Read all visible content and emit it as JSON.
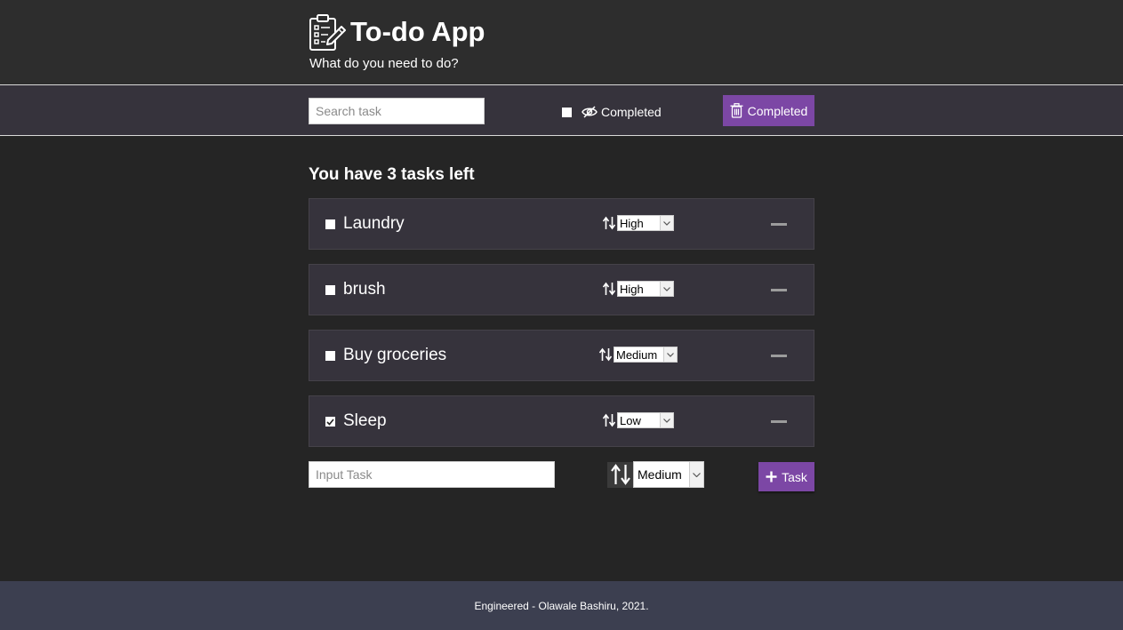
{
  "header": {
    "title": "To-do App",
    "subtitle": "What do you need to do?",
    "logo_icon": "clipboard-pencil-icon"
  },
  "toolbar": {
    "search_placeholder": "Search task",
    "hide_completed_label": "Completed",
    "hide_completed_checked": false,
    "hide_icon": "eye-slash-icon",
    "clear_completed_label": "Completed",
    "clear_icon": "trash-icon"
  },
  "summary": {
    "text": "You have 3 tasks left"
  },
  "tasks": [
    {
      "name": "Laundry",
      "priority": "High",
      "completed": false
    },
    {
      "name": "brush",
      "priority": "High",
      "completed": false
    },
    {
      "name": "Buy groceries",
      "priority": "Medium",
      "completed": false
    },
    {
      "name": "Sleep",
      "priority": "Low",
      "completed": true
    }
  ],
  "new_task": {
    "placeholder": "Input Task",
    "priority": "Medium",
    "add_label": "Task"
  },
  "footer": {
    "text": "Engineered - Olawale Bashiru, 2021."
  },
  "colors": {
    "accent": "#7c47a5",
    "background": "#252525",
    "header": "#2d2d2d",
    "panel": "#36333c",
    "footer": "#3c3f50"
  }
}
